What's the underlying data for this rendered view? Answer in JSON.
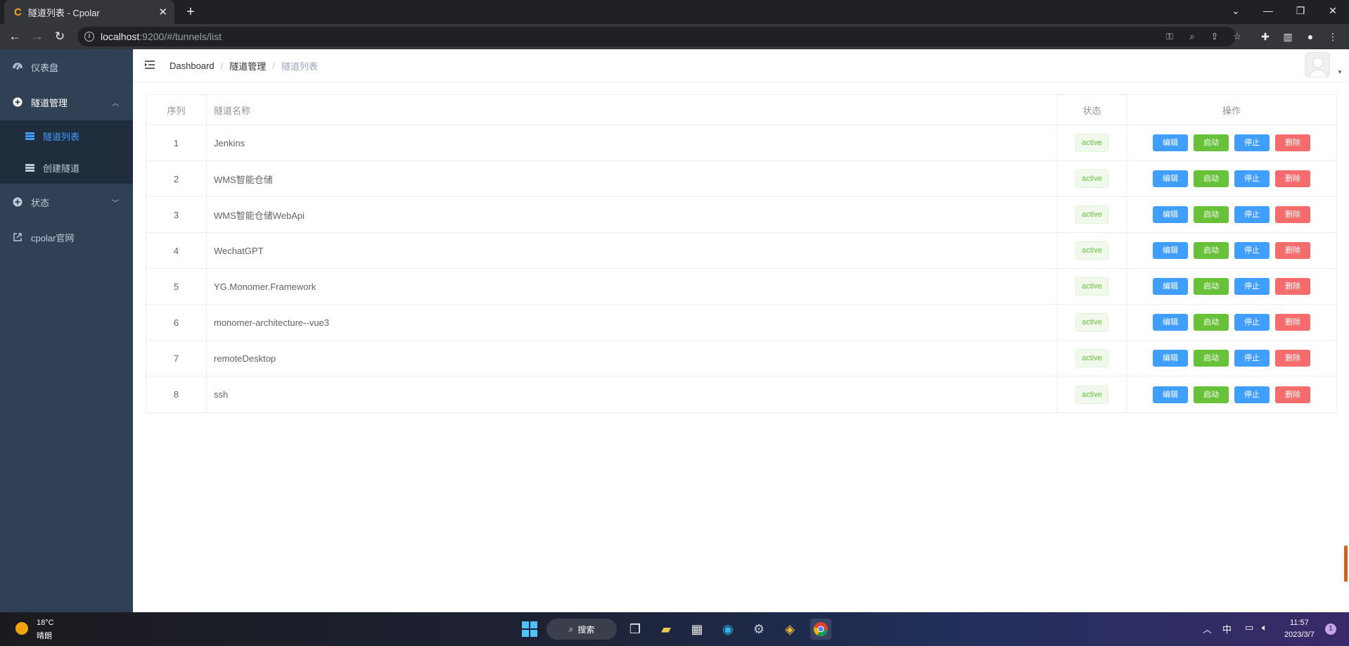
{
  "browser": {
    "tab_title": "隧道列表 - Cpolar",
    "url_host": "localhost",
    "url_rest": ":9200/#/tunnels/list"
  },
  "sidebar": {
    "items": [
      {
        "label": "仪表盘",
        "icon": "dashboard-icon"
      },
      {
        "label": "隧道管理",
        "icon": "plus-circle-icon"
      },
      {
        "label": "状态",
        "icon": "plus-circle-icon"
      },
      {
        "label": "cpolar官网",
        "icon": "external-link-icon"
      }
    ],
    "submenu": [
      {
        "label": "隧道列表",
        "active": true
      },
      {
        "label": "创建隧道",
        "active": false
      }
    ]
  },
  "breadcrumb": [
    "Dashboard",
    "隧道管理",
    "隧道列表"
  ],
  "table": {
    "headers": [
      "序列",
      "隧道名称",
      "状态",
      "操作"
    ],
    "rows": [
      {
        "idx": "1",
        "name": "Jenkins",
        "status": "active"
      },
      {
        "idx": "2",
        "name": "WMS智能仓储",
        "status": "active"
      },
      {
        "idx": "3",
        "name": "WMS智能仓储WebApi",
        "status": "active"
      },
      {
        "idx": "4",
        "name": "WechatGPT",
        "status": "active"
      },
      {
        "idx": "5",
        "name": "YG.Monomer.Framework",
        "status": "active"
      },
      {
        "idx": "6",
        "name": "monomer-architecture--vue3",
        "status": "active"
      },
      {
        "idx": "7",
        "name": "remoteDesktop",
        "status": "active"
      },
      {
        "idx": "8",
        "name": "ssh",
        "status": "active"
      }
    ],
    "actions": {
      "edit": "编辑",
      "start": "启动",
      "stop": "停止",
      "delete": "删除"
    }
  },
  "taskbar": {
    "weather_temp": "18°C",
    "weather_desc": "晴朗",
    "search_label": "搜索",
    "ime": "中",
    "time": "11:57",
    "date": "2023/3/7",
    "notifications": "1"
  },
  "colors": {
    "sidebar_bg": "#304156",
    "submenu_bg": "#1f2d3d",
    "primary": "#409eff",
    "success": "#67c23a",
    "danger": "#f56c6c"
  }
}
